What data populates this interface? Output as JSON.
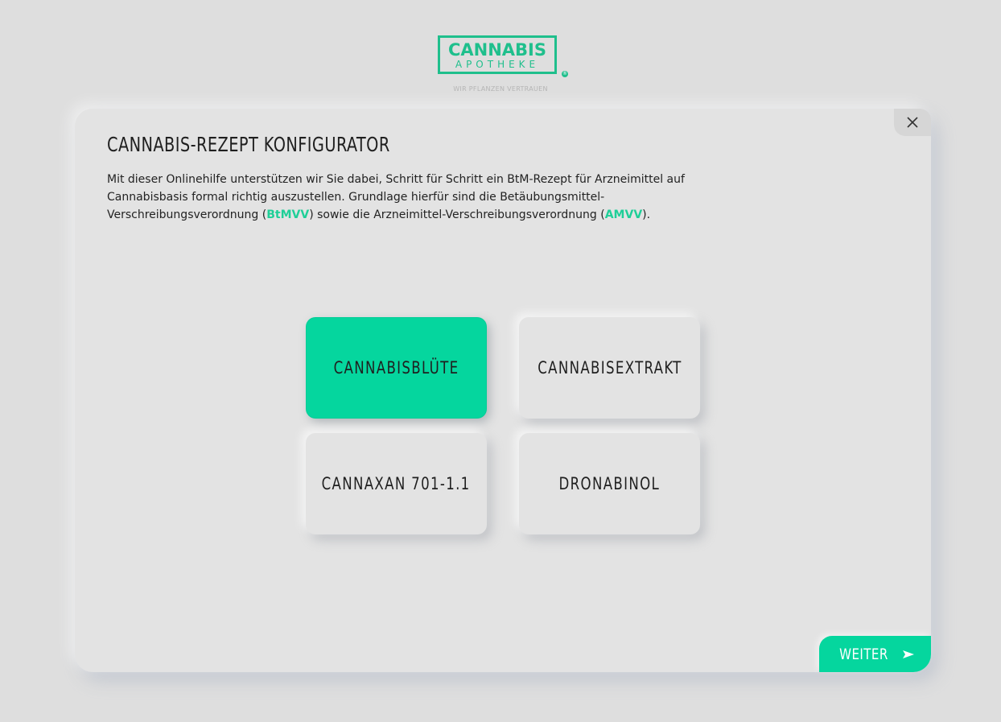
{
  "logo": {
    "word1": "CANNABIS",
    "word2": "APOTHEKE",
    "registered": "®",
    "tagline": "WIR PFLANZEN VERTRAUEN",
    "color": "#1fbf8c"
  },
  "dialog": {
    "title": "CANNABIS-REZEPT KONFIGURATOR",
    "intro": {
      "part1": "Mit dieser Onlinehilfe unterstützen wir Sie dabei, Schritt für Schritt ein BtM-Rezept für Arzneimittel auf Cannabisbasis formal richtig auszustellen. Grundlage hierfür sind die Betäubungsmittel-Verschreibungsverordnung (",
      "link1": "BtMVV",
      "part2": ") sowie die Arzneimittel-Verschreibungsverordnung (",
      "link2": "AMVV",
      "part3": ")."
    },
    "close_icon": "close-icon",
    "options": [
      {
        "label": "CANNABISBLÜTE",
        "selected": true
      },
      {
        "label": "CANNABISEXTRAKT",
        "selected": false
      },
      {
        "label": "CANNAXAN 701-1.1",
        "selected": false
      },
      {
        "label": "DRONABINOL",
        "selected": false
      }
    ],
    "next_button": {
      "label": "WEITER",
      "icon": "arrow-right-icon"
    }
  },
  "colors": {
    "accent": "#05d69e",
    "background": "#dedede",
    "card": "#e3e3e3"
  }
}
